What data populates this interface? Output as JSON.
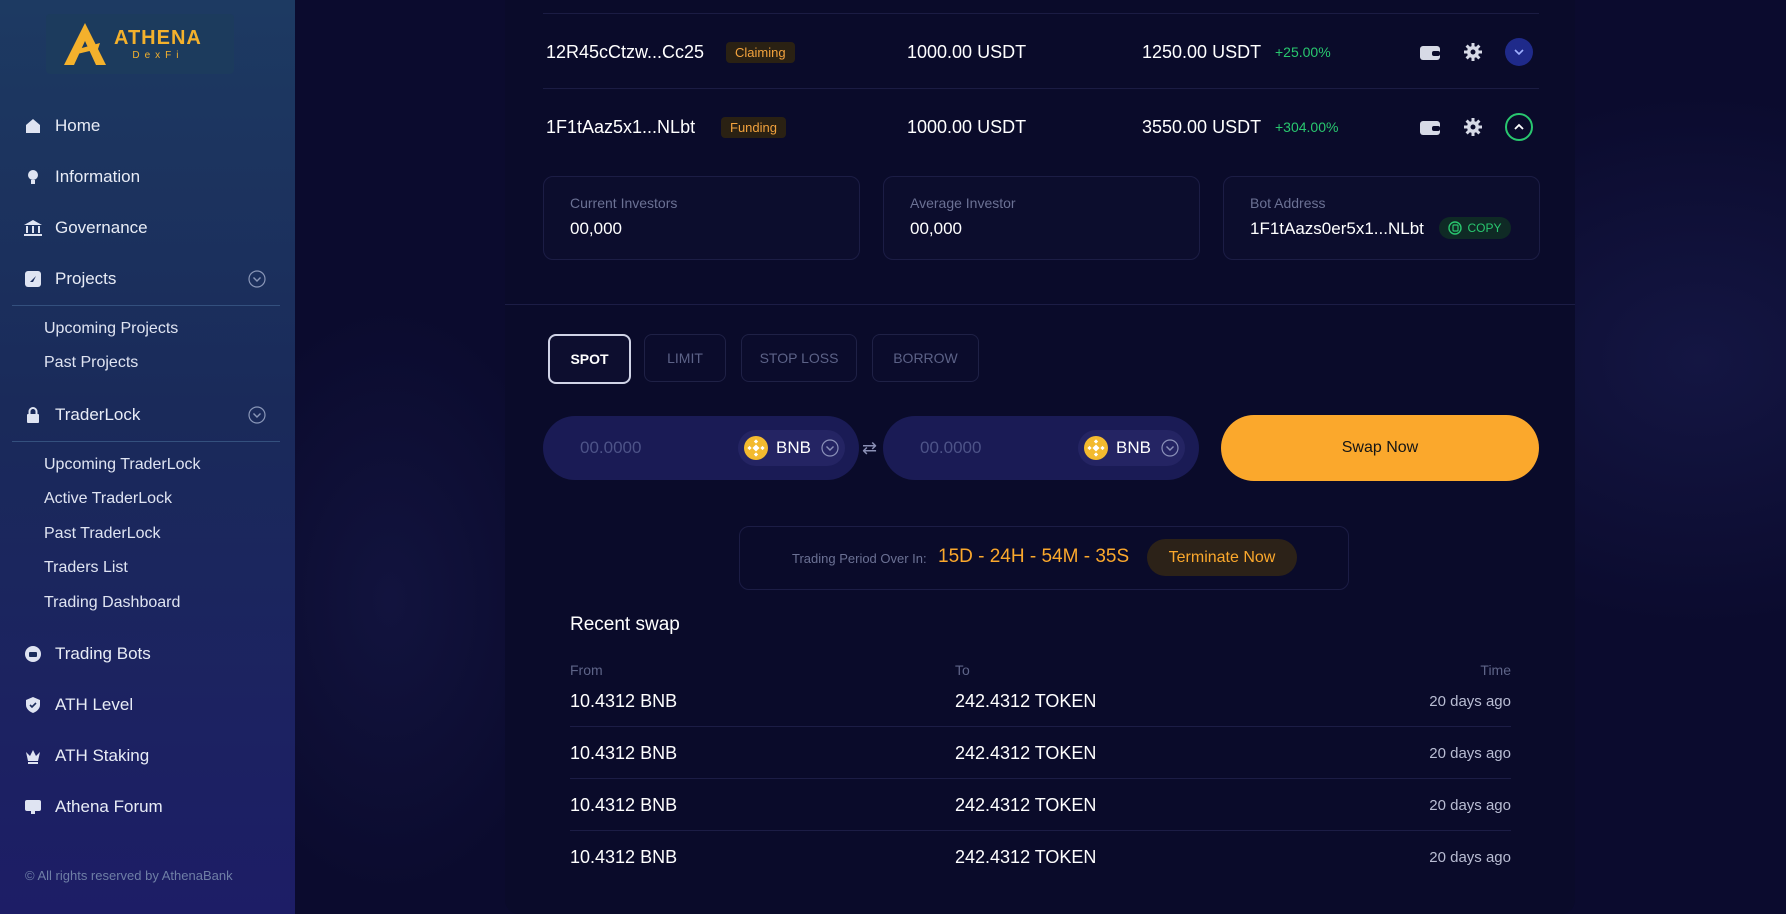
{
  "brand": {
    "name": "ATHENA",
    "sub": "DexFi"
  },
  "sidebar": {
    "items": [
      {
        "label": "Home",
        "icon": "home-icon"
      },
      {
        "label": "Information",
        "icon": "lightbulb-icon"
      },
      {
        "label": "Governance",
        "icon": "bank-icon"
      },
      {
        "label": "Projects",
        "icon": "projects-icon"
      },
      {
        "label": "TraderLock",
        "icon": "lock-icon"
      },
      {
        "label": "Trading Bots",
        "icon": "bot-icon"
      },
      {
        "label": "ATH Level",
        "icon": "shield-icon"
      },
      {
        "label": "ATH Staking",
        "icon": "crown-icon"
      },
      {
        "label": "Athena Forum",
        "icon": "chat-icon"
      }
    ],
    "projects_sub": [
      "Upcoming Projects",
      "Past Projects"
    ],
    "traderlock_sub": [
      "Upcoming TraderLock",
      "Active TraderLock",
      "Past TraderLock",
      "Traders List",
      "Trading Dashboard"
    ],
    "copyright": "© All rights reserved by AthenaBank"
  },
  "bots": [
    {
      "address": "12R45cCtzw...Cc25",
      "status": "Claiming",
      "invested": "1000.00 USDT",
      "value": "1250.00 USDT",
      "change": "+25.00%"
    },
    {
      "address": "1F1tAaz5x1...NLbt",
      "status": "Funding",
      "invested": "1000.00 USDT",
      "value": "3550.00 USDT",
      "change": "+304.00%"
    }
  ],
  "details": {
    "current_investors_label": "Current Investors",
    "current_investors_value": "00,000",
    "average_investor_label": "Average Investor",
    "average_investor_value": "00,000",
    "bot_address_label": "Bot Address",
    "bot_address_value": "1F1tAazs0er5x1...NLbt",
    "copy_label": "COPY"
  },
  "order_tabs": [
    "SPOT",
    "LIMIT",
    "STOP LOSS",
    "BORROW"
  ],
  "swap": {
    "from_placeholder": "00.0000",
    "to_placeholder": "00.0000",
    "from_token": "BNB",
    "to_token": "BNB",
    "button": "Swap Now"
  },
  "period": {
    "label": "Trading Period Over In:",
    "time": "15D - 24H - 54M - 35S",
    "terminate": "Terminate Now"
  },
  "recent": {
    "title": "Recent swap",
    "headers": {
      "from": "From",
      "to": "To",
      "time": "Time"
    },
    "rows": [
      {
        "from": "10.4312 BNB",
        "to": "242.4312 TOKEN",
        "time": "20 days ago"
      },
      {
        "from": "10.4312 BNB",
        "to": "242.4312 TOKEN",
        "time": "20 days ago"
      },
      {
        "from": "10.4312 BNB",
        "to": "242.4312 TOKEN",
        "time": "20 days ago"
      },
      {
        "from": "10.4312 BNB",
        "to": "242.4312 TOKEN",
        "time": "20 days ago"
      }
    ]
  },
  "colors": {
    "accent": "#fba82c",
    "positive": "#29c76f",
    "tag_bg": "#2a2113"
  }
}
